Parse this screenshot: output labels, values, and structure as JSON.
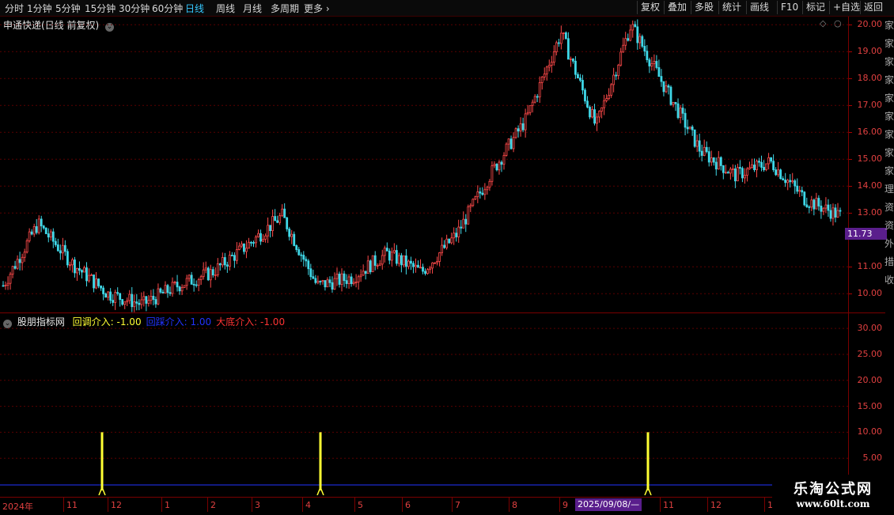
{
  "topbar": {
    "periods": [
      "分时",
      "1分钟",
      "5分钟",
      "15分钟",
      "30分钟",
      "60分钟",
      "日线",
      "周线",
      "月线",
      "多周期",
      "更多"
    ],
    "active_period": "日线",
    "right_buttons": [
      "复权",
      "叠加",
      "多股",
      "统计",
      "画线",
      "F10",
      "标记",
      "+自选",
      "返回"
    ]
  },
  "main_panel": {
    "title": "申通快递(日线 前复权)",
    "price_axis": [
      "20.00",
      "19.00",
      "18.00",
      "17.00",
      "16.00",
      "15.00",
      "14.00",
      "13.00",
      "11.00",
      "10.00"
    ],
    "current_price": "11.73"
  },
  "indicator_panel": {
    "name": "股朋指标网",
    "legend": [
      {
        "label": "回调介入: -1.00",
        "color": "#ffff33"
      },
      {
        "label": "回踩介入: 1.00",
        "color": "#2233ff"
      },
      {
        "label": "大底介入: -1.00",
        "color": "#ff3333"
      }
    ],
    "axis": [
      "30.00",
      "25.00",
      "20.00",
      "15.00",
      "10.00",
      "5.00"
    ]
  },
  "date_axis": {
    "year_label": "2024年",
    "months": [
      "11",
      "12",
      "1",
      "2",
      "3",
      "4",
      "5",
      "6",
      "7",
      "8",
      "9",
      "11",
      "12",
      "1"
    ],
    "cursor_date": "2025/09/08/—"
  },
  "watermark": {
    "line1": "乐淘公式网",
    "line2": "www.60lt.com"
  },
  "right_strip_chars": [
    "家",
    "家",
    "家",
    "家",
    "家",
    "家",
    "家",
    "家",
    "家",
    "理",
    "资",
    "资",
    "外",
    "措",
    "收"
  ],
  "chart_data": {
    "type": "candlestick",
    "title": "申通快递(日线 前复权)",
    "ylim": [
      9.3,
      20.3
    ],
    "approx_close_path": [
      {
        "x": "2024-10",
        "y": 10.3
      },
      {
        "x": "2024-10",
        "y": 12.6
      },
      {
        "x": "2024-11",
        "y": 11.1
      },
      {
        "x": "2024-12",
        "y": 10.0
      },
      {
        "x": "2024-12",
        "y": 9.6
      },
      {
        "x": "2025-01",
        "y": 10.3
      },
      {
        "x": "2025-02",
        "y": 10.8
      },
      {
        "x": "2025-03",
        "y": 11.8
      },
      {
        "x": "2025-03",
        "y": 12.9
      },
      {
        "x": "2025-04",
        "y": 10.3
      },
      {
        "x": "2025-05",
        "y": 10.6
      },
      {
        "x": "2025-06",
        "y": 11.5
      },
      {
        "x": "2025-06",
        "y": 10.8
      },
      {
        "x": "2025-07",
        "y": 12.2
      },
      {
        "x": "2025-07",
        "y": 14.5
      },
      {
        "x": "2025-08",
        "y": 16.5
      },
      {
        "x": "2025-08",
        "y": 19.7
      },
      {
        "x": "2025-09",
        "y": 16.2
      },
      {
        "x": "2025-09",
        "y": 20.0
      },
      {
        "x": "2025-10",
        "y": 17.6
      },
      {
        "x": "2025-10",
        "y": 15.3
      },
      {
        "x": "2025-11",
        "y": 14.4
      },
      {
        "x": "2025-11",
        "y": 14.9
      },
      {
        "x": "2025-12",
        "y": 13.5
      },
      {
        "x": "2026-01",
        "y": 12.9
      }
    ],
    "indicator_spikes": [
      {
        "series": "回调介入",
        "x": "2024-11",
        "y": 10.0
      },
      {
        "series": "回调介入",
        "x": "2025-04",
        "y": 10.0
      },
      {
        "series": "回调介入",
        "x": "2025-10",
        "y": 10.0
      }
    ],
    "indicator_ylim": [
      0,
      32
    ]
  }
}
